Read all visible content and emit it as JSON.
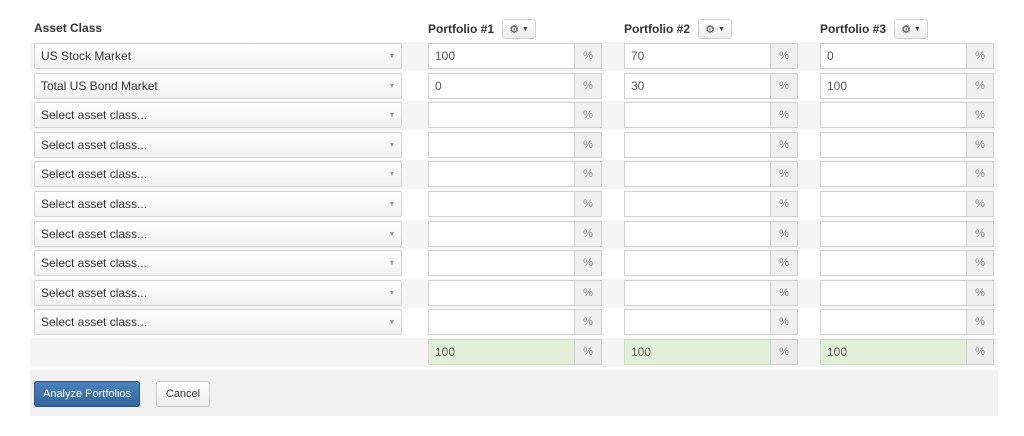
{
  "header": {
    "asset_class_label": "Asset Class",
    "portfolios": [
      {
        "title": "Portfolio #1",
        "settings_icon": "gear-icon"
      },
      {
        "title": "Portfolio #2",
        "settings_icon": "gear-icon"
      },
      {
        "title": "Portfolio #3",
        "settings_icon": "gear-icon"
      }
    ]
  },
  "unit": "%",
  "rows": [
    {
      "asset": "US Stock Market",
      "values": [
        "100",
        "70",
        "0"
      ]
    },
    {
      "asset": "Total US Bond Market",
      "values": [
        "0",
        "30",
        "100"
      ]
    },
    {
      "asset": "Select asset class...",
      "values": [
        "",
        "",
        ""
      ]
    },
    {
      "asset": "Select asset class...",
      "values": [
        "",
        "",
        ""
      ]
    },
    {
      "asset": "Select asset class...",
      "values": [
        "",
        "",
        ""
      ]
    },
    {
      "asset": "Select asset class...",
      "values": [
        "",
        "",
        ""
      ]
    },
    {
      "asset": "Select asset class...",
      "values": [
        "",
        "",
        ""
      ]
    },
    {
      "asset": "Select asset class...",
      "values": [
        "",
        "",
        ""
      ]
    },
    {
      "asset": "Select asset class...",
      "values": [
        "",
        "",
        ""
      ]
    },
    {
      "asset": "Select asset class...",
      "values": [
        "",
        "",
        ""
      ]
    }
  ],
  "totals": [
    "100",
    "100",
    "100"
  ],
  "actions": {
    "analyze_label": "Analyze Portfolios",
    "cancel_label": "Cancel"
  },
  "colors": {
    "primary_button": "#3a6ea8",
    "total_fill": "#e1efd8"
  }
}
